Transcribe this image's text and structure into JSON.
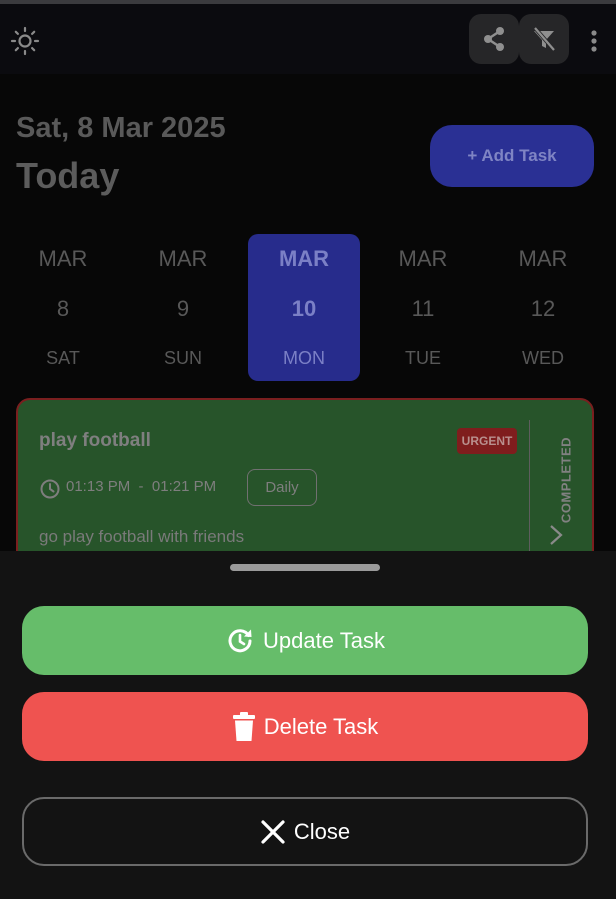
{
  "header": {
    "theme_icon": "sun-icon",
    "share_icon": "share-icon",
    "filter_icon": "filter-off-icon",
    "more_icon": "more-vertical-icon"
  },
  "main": {
    "date": "Sat, 8 Mar 2025",
    "title": "Today",
    "add_task_label": "+ Add Task"
  },
  "calendar": [
    {
      "month": "MAR",
      "day": "8",
      "weekday": "SAT",
      "selected": false
    },
    {
      "month": "MAR",
      "day": "9",
      "weekday": "SUN",
      "selected": false
    },
    {
      "month": "MAR",
      "day": "10",
      "weekday": "MON",
      "selected": true
    },
    {
      "month": "MAR",
      "day": "11",
      "weekday": "TUE",
      "selected": false
    },
    {
      "month": "MAR",
      "day": "12",
      "weekday": "WED",
      "selected": false
    }
  ],
  "task": {
    "title": "play football",
    "priority": "URGENT",
    "start_time": "01:13 PM",
    "end_time": "01:21 PM",
    "repeat": "Daily",
    "description": "go play football with friends",
    "status": "COMPLETED"
  },
  "sheet": {
    "update_label": "Update Task",
    "delete_label": "Delete Task",
    "close_label": "Close"
  },
  "colors": {
    "accent": "#2a3094",
    "card": "#27542a",
    "update": "#66bd6a",
    "delete": "#ef5350"
  }
}
